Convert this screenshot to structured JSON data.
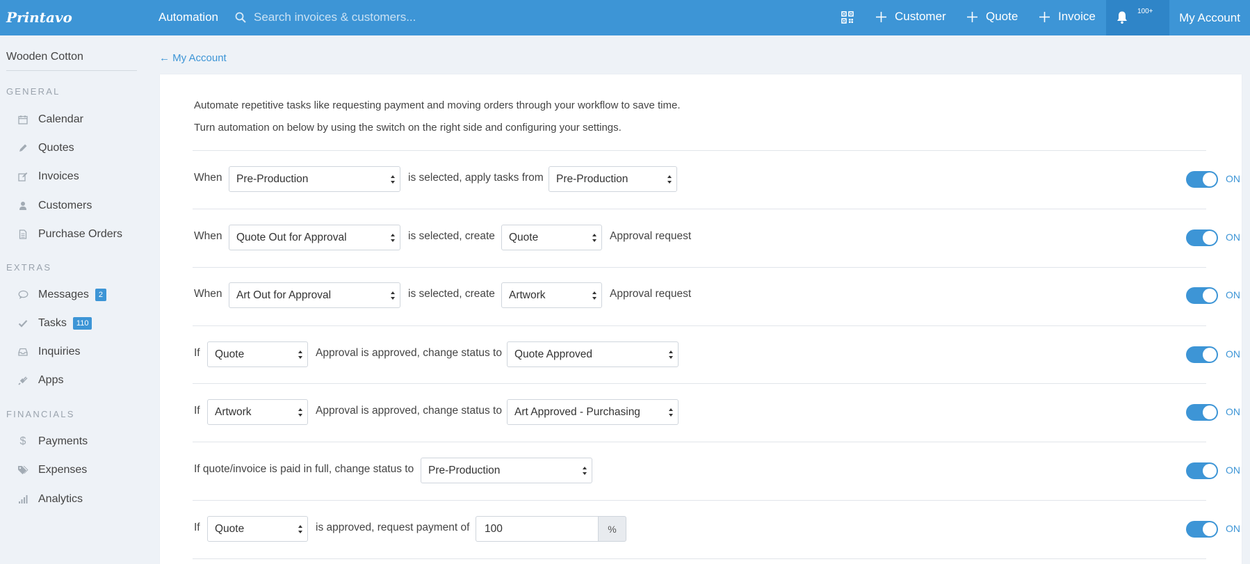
{
  "topbar": {
    "logo": "Printavo",
    "title": "Automation",
    "search_placeholder": "Search invoices & customers...",
    "actions": [
      {
        "label": "Customer"
      },
      {
        "label": "Quote"
      },
      {
        "label": "Invoice"
      }
    ],
    "notification_count": "100+",
    "account_label": "My Account",
    "accent_color": "#3d95d6"
  },
  "sidebar": {
    "company": "Wooden Cotton",
    "sections": {
      "general": "GENERAL",
      "extras": "EXTRAS",
      "financials": "FINANCIALS"
    },
    "items": [
      {
        "label": "Calendar",
        "icon": "calendar-icon"
      },
      {
        "label": "Quotes",
        "icon": "pencil-icon"
      },
      {
        "label": "Invoices",
        "icon": "edit-icon"
      },
      {
        "label": "Customers",
        "icon": "user-icon"
      },
      {
        "label": "Purchase Orders",
        "icon": "document-icon"
      },
      {
        "label": "Messages",
        "icon": "chat-icon",
        "badge": "2"
      },
      {
        "label": "Tasks",
        "icon": "check-icon",
        "badge": "110"
      },
      {
        "label": "Inquiries",
        "icon": "inbox-icon"
      },
      {
        "label": "Apps",
        "icon": "plug-icon"
      },
      {
        "label": "Payments",
        "icon": "dollar-icon"
      },
      {
        "label": "Expenses",
        "icon": "tags-icon"
      },
      {
        "label": "Analytics",
        "icon": "bar-chart-icon"
      }
    ]
  },
  "main": {
    "back_link": "← My Account",
    "intro_1": "Automate repetitive tasks like requesting payment and moving orders through your workflow to save time.",
    "intro_2": "Turn automation on below by using the switch on the right side and configuring your settings.",
    "toggle_label": "ON",
    "rules": [
      {
        "t1": "When",
        "s1": "Pre-Production",
        "t2": "is selected, apply tasks from",
        "s2": "Pre-Production"
      },
      {
        "t1": "When",
        "s1": "Quote Out for Approval",
        "t2": "is selected, create",
        "s2": "Quote",
        "t3": "Approval request"
      },
      {
        "t1": "When",
        "s1": "Art Out for Approval",
        "t2": "is selected, create",
        "s2": "Artwork",
        "t3": "Approval request"
      },
      {
        "t1": "If",
        "s1": "Quote",
        "t2": "Approval is approved, change status to",
        "s2": "Quote Approved"
      },
      {
        "t1": "If",
        "s1": "Artwork",
        "t2": "Approval is approved, change status to",
        "s2": "Art Approved - Purchasing"
      },
      {
        "t1": "If quote/invoice is paid in full, change status to",
        "s1": "Pre-Production"
      },
      {
        "t1": "If",
        "s1": "Quote",
        "t2": "is approved, request payment of",
        "value": "100",
        "addon": "%"
      }
    ]
  }
}
